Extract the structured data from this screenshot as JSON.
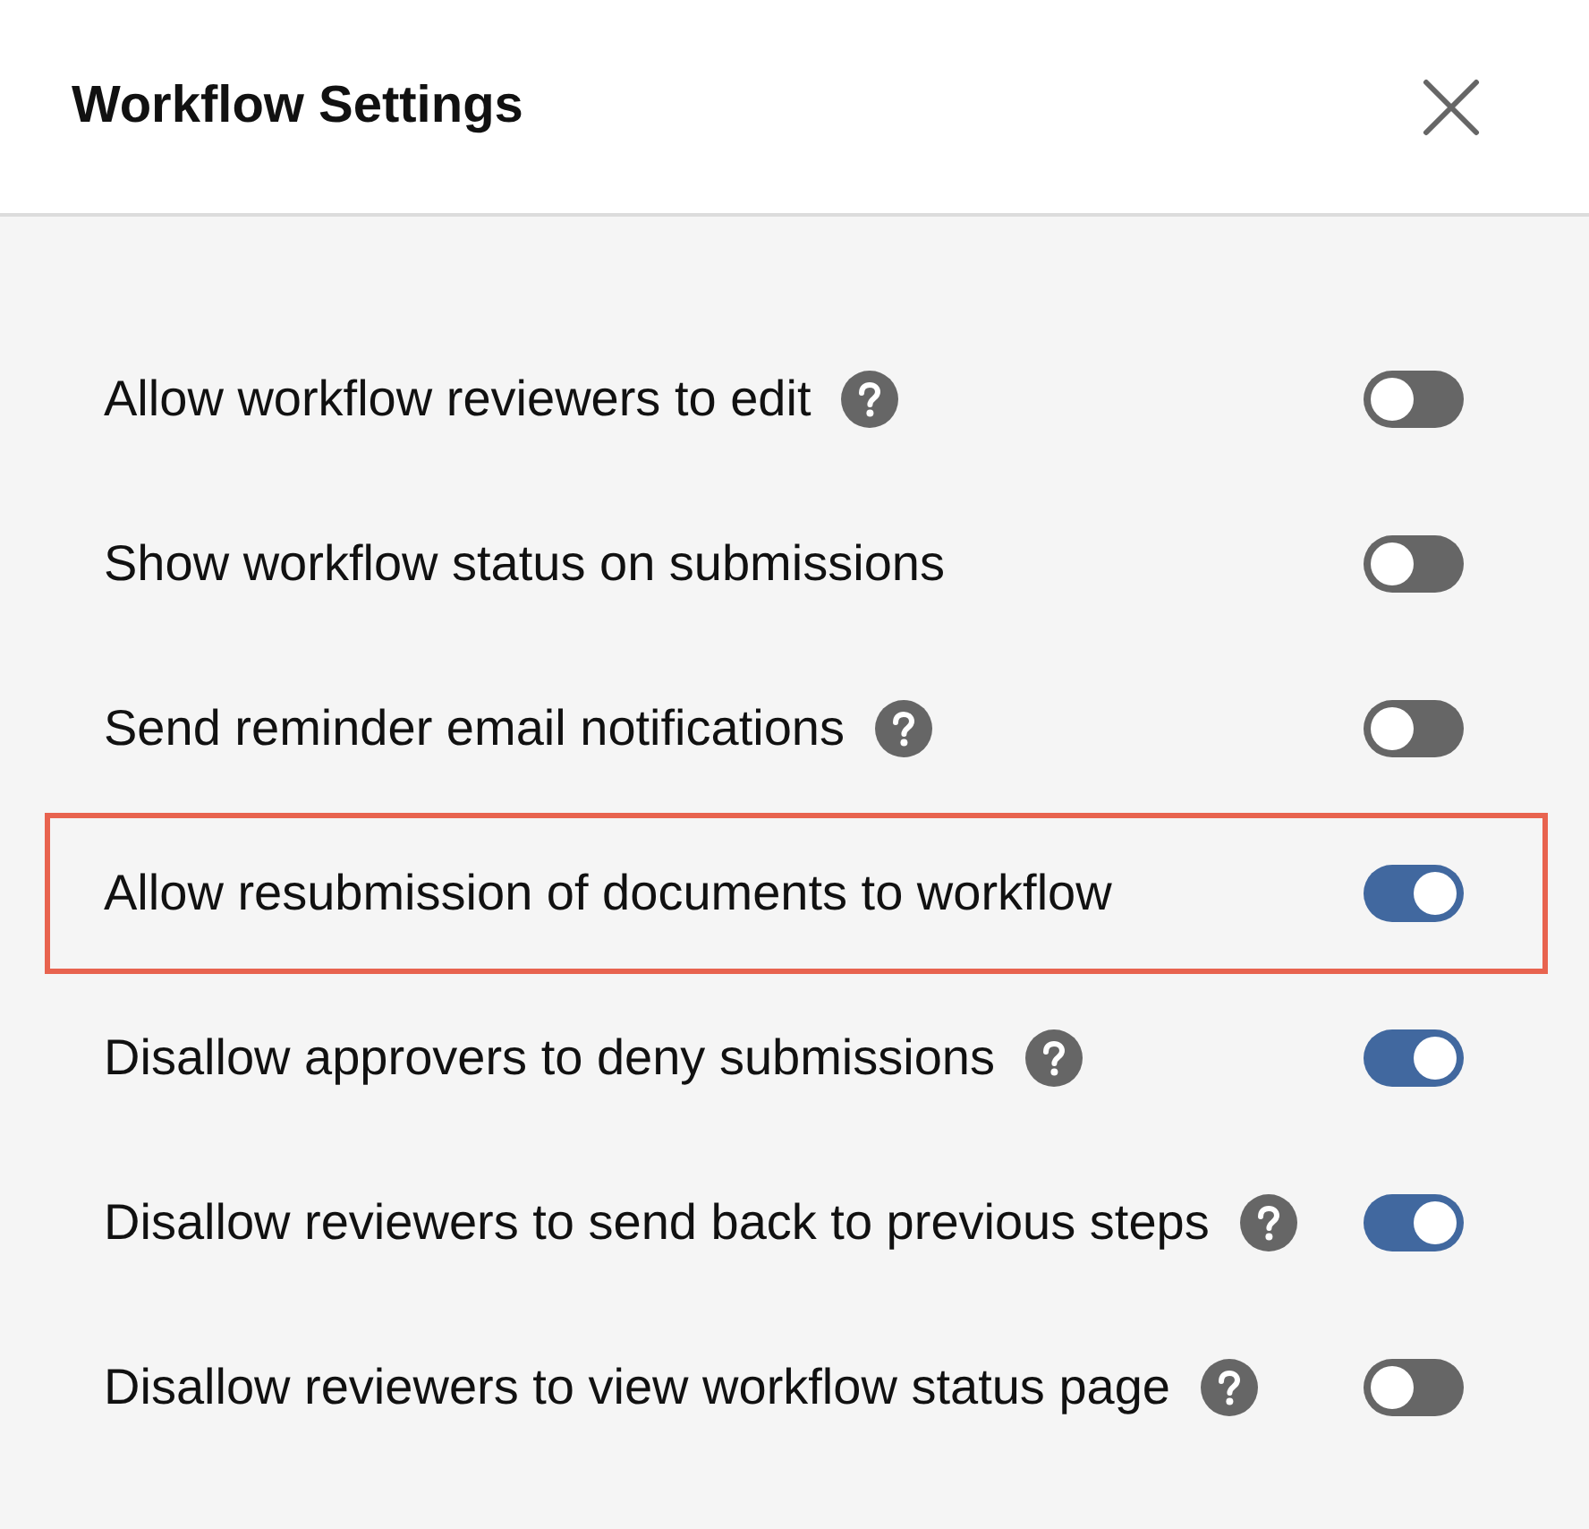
{
  "dialog": {
    "title": "Workflow Settings",
    "close_button": true
  },
  "settings": [
    {
      "label": "Allow workflow reviewers to edit",
      "help": true,
      "on": false,
      "highlighted": false
    },
    {
      "label": "Show workflow status on submissions",
      "help": false,
      "on": false,
      "highlighted": false
    },
    {
      "label": "Send reminder email notifications",
      "help": true,
      "on": false,
      "highlighted": false
    },
    {
      "label": "Allow resubmission of documents to workflow",
      "help": false,
      "on": true,
      "highlighted": true
    },
    {
      "label": "Disallow approvers to deny submissions",
      "help": true,
      "on": true,
      "highlighted": false
    },
    {
      "label": "Disallow reviewers to send back to previous steps",
      "help": true,
      "on": true,
      "highlighted": false
    },
    {
      "label": "Disallow reviewers to view workflow status page",
      "help": true,
      "on": false,
      "highlighted": false
    }
  ]
}
